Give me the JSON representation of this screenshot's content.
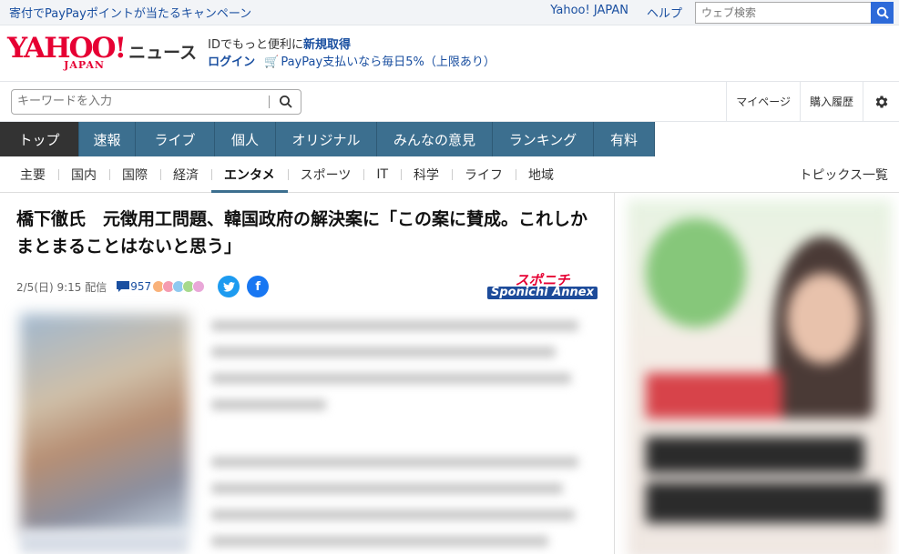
{
  "topbar": {
    "campaign": "寄付でPayPayポイントが当たるキャンペーン",
    "links": [
      "Yahoo! JAPAN",
      "ヘルプ"
    ],
    "search_placeholder": "ウェブ検索"
  },
  "logo": {
    "yahoo": "YAHOO!",
    "japan": "JAPAN",
    "section": "ニュース"
  },
  "id_promo": {
    "line1_prefix": "IDでもっと便利に",
    "line1_link": "新規取得",
    "login": "ログイン",
    "paypay": "PayPay支払いなら毎日5%（上限あり）"
  },
  "search": {
    "placeholder": "キーワードを入力"
  },
  "right_menu": {
    "mypage": "マイページ",
    "history": "購入履歴"
  },
  "main_nav": [
    {
      "label": "トップ",
      "active": true
    },
    {
      "label": "速報"
    },
    {
      "label": "ライブ"
    },
    {
      "label": "個人"
    },
    {
      "label": "オリジナル"
    },
    {
      "label": "みんなの意見"
    },
    {
      "label": "ランキング"
    },
    {
      "label": "有料"
    }
  ],
  "sub_nav": [
    {
      "label": "主要"
    },
    {
      "label": "国内"
    },
    {
      "label": "国際"
    },
    {
      "label": "経済"
    },
    {
      "label": "エンタメ",
      "active": true
    },
    {
      "label": "スポーツ"
    },
    {
      "label": "IT"
    },
    {
      "label": "科学"
    },
    {
      "label": "ライフ"
    },
    {
      "label": "地域"
    }
  ],
  "topics_link": "トピックス一覧",
  "article": {
    "headline": "橋下徹氏　元徴用工問題、韓国政府の解決案に「この案に賛成。これしかまとまることはないと思う」",
    "date": "2/5(日) 9:15 配信",
    "comment_count": "957",
    "source_line1": "スポニチ",
    "source_line2": "Sponichi Annex"
  },
  "colors": {
    "nav_bg": "#3c6f8f",
    "nav_active": "#333333",
    "link": "#1a4fa0",
    "yahoo_red": "#e60033",
    "twitter": "#1d9bf0",
    "facebook": "#1877f2"
  }
}
